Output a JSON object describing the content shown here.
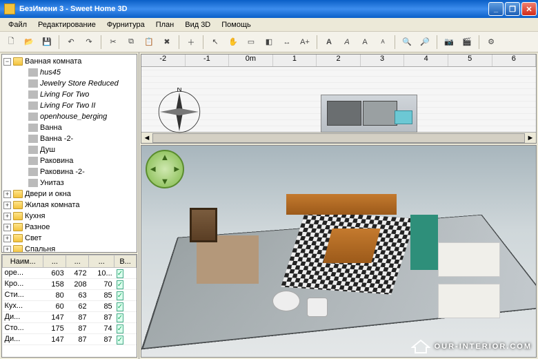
{
  "window": {
    "title": "БезИмени 3 - Sweet Home 3D"
  },
  "menu": {
    "file": "Файл",
    "edit": "Редактирование",
    "furniture": "Фурнитура",
    "plan": "План",
    "view3d": "Вид 3D",
    "help": "Помощь"
  },
  "tree": {
    "root": "Ванная комната",
    "children": [
      "hus45",
      "Jewelry Store Reduced",
      "Living For Two",
      "Living For Two II",
      "openhouse_berging",
      "Ванна",
      "Ванна -2-",
      "Душ",
      "Раковина",
      "Раковина -2-",
      "Унитаз"
    ],
    "siblings": [
      "Двери и окна",
      "Жилая комната",
      "Кухня",
      "Разное",
      "Свет",
      "Спальня"
    ]
  },
  "table": {
    "cols": [
      "Наим...",
      "...",
      "...",
      "...",
      "В..."
    ],
    "rows": [
      {
        "n": "оре...",
        "a": "603",
        "b": "472",
        "c": "10...",
        "v": true
      },
      {
        "n": "Кро...",
        "a": "158",
        "b": "208",
        "c": "70",
        "v": true
      },
      {
        "n": "Сти...",
        "a": "80",
        "b": "63",
        "c": "85",
        "v": true
      },
      {
        "n": "Кух...",
        "a": "60",
        "b": "62",
        "c": "85",
        "v": true
      },
      {
        "n": "Ди...",
        "a": "147",
        "b": "87",
        "c": "87",
        "v": true
      },
      {
        "n": "Сто...",
        "a": "175",
        "b": "87",
        "c": "74",
        "v": true
      },
      {
        "n": "Ди...",
        "a": "147",
        "b": "87",
        "c": "87",
        "v": true
      }
    ]
  },
  "ruler": [
    "-2",
    "-1",
    "0m",
    "1",
    "2",
    "3",
    "4",
    "5",
    "6"
  ],
  "watermark": "OUR-INTERIOR.COM",
  "compass_label": "N"
}
